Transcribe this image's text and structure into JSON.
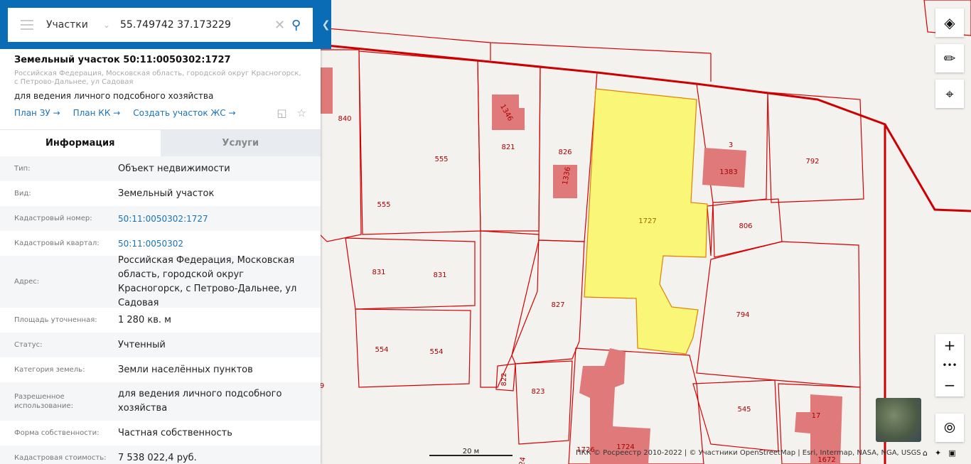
{
  "search": {
    "layer": "Участки",
    "query": "55.749742 37.173229"
  },
  "parcel": {
    "title": "Земельный участок 50:11:0050302:1727",
    "address": "Российская Федерация, Московская область, городской округ Красногорск, с Петрово-Дальнее, ул Садовая",
    "purpose": "для ведения личного подсобного хозяйства",
    "links": [
      "План ЗУ →",
      "План КК →",
      "Создать участок ЖС →"
    ]
  },
  "tabs": [
    "Информация",
    "Услуги"
  ],
  "info": [
    {
      "k": "Тип:",
      "v": "Объект недвижимости"
    },
    {
      "k": "Вид:",
      "v": "Земельный участок"
    },
    {
      "k": "Кадастровый номер:",
      "v": "50:11:0050302:1727",
      "link": true
    },
    {
      "k": "Кадастровый квартал:",
      "v": "50:11:0050302",
      "link": true
    },
    {
      "k": "Адрес:",
      "v": "Российская Федерация, Московская область, городской округ Красногорск, с Петрово-Дальнее, ул Садовая"
    },
    {
      "k": "Площадь уточненная:",
      "v": "1 280 кв. м"
    },
    {
      "k": "Статус:",
      "v": "Учтенный"
    },
    {
      "k": "Категория земель:",
      "v": "Земли населённых пунктов"
    },
    {
      "k": "Разрешенное использование:",
      "v": "для ведения личного подсобного хозяйства"
    },
    {
      "k": "Форма собственности:",
      "v": "Частная собственность"
    },
    {
      "k": "Кадастровая стоимость:",
      "v": "7 538 022,4 руб."
    }
  ],
  "map": {
    "labels": [
      "840",
      "555",
      "821",
      "826",
      "1336",
      "1346",
      "555",
      "3",
      "1383",
      "792",
      "1727",
      "806",
      "831",
      "831",
      "827",
      "794",
      "554",
      "554",
      "822",
      "823",
      "545",
      "17",
      "1726",
      "1724",
      "1672",
      "9",
      "24"
    ],
    "scale": "20 м",
    "attribution": "ПКК © Росреестр 2010-2022 | © Участники OpenStreetMap | Esri, Intermap, NASA, NGA, USGS"
  }
}
